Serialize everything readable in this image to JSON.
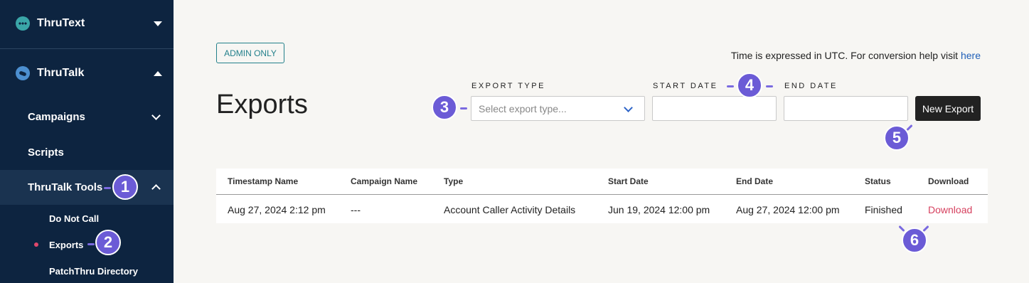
{
  "sidebar": {
    "thrutext": {
      "label": "ThruText"
    },
    "thrutalk": {
      "label": "ThruTalk"
    },
    "items": [
      {
        "label": "Campaigns"
      },
      {
        "label": "Scripts"
      },
      {
        "label": "ThruTalk Tools"
      }
    ],
    "subitems": [
      {
        "label": "Do Not Call"
      },
      {
        "label": "Exports"
      },
      {
        "label": "PatchThru Directory"
      }
    ]
  },
  "callouts": [
    "1",
    "2",
    "3",
    "4",
    "5",
    "6"
  ],
  "header": {
    "admin_badge": "ADMIN ONLY",
    "utc_text": "Time is expressed in UTC. For conversion help visit ",
    "utc_link": "here",
    "title": "Exports"
  },
  "form": {
    "export_type_label": "EXPORT TYPE",
    "export_type_placeholder": "Select export type...",
    "start_date_label": "START DATE",
    "end_date_label": "END DATE",
    "new_export_button": "New Export"
  },
  "table": {
    "columns": [
      "Timestamp Name",
      "Campaign Name",
      "Type",
      "Start Date",
      "End Date",
      "Status",
      "Download"
    ],
    "rows": [
      [
        "Aug 27, 2024 2:12 pm",
        "---",
        "Account Caller Activity Details",
        "Jun 19, 2024 12:00 pm",
        "Aug 27, 2024 12:00 pm",
        "Finished",
        "Download"
      ]
    ]
  },
  "colors": {
    "sidebar_bg": "#0d2440",
    "accent": "#6b5bd6",
    "link": "#d6415f",
    "admin": "#23808b"
  }
}
